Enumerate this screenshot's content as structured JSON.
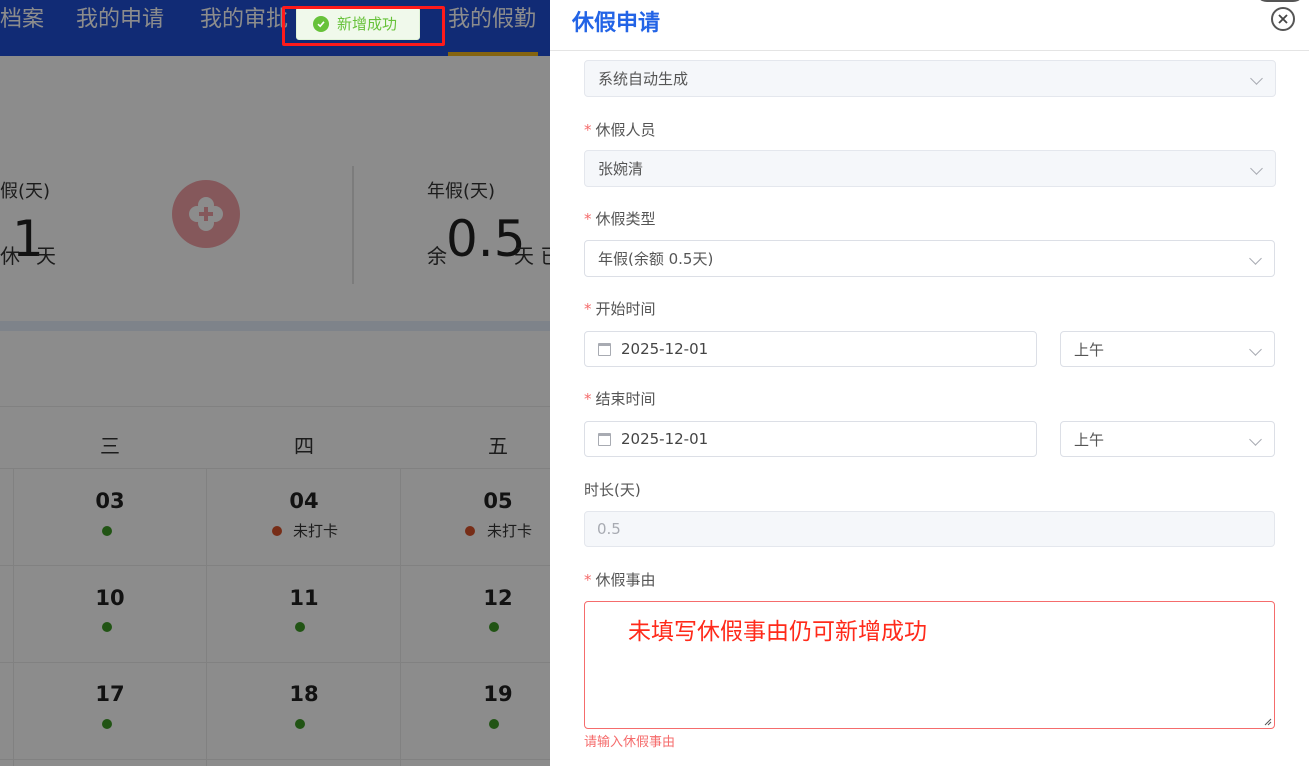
{
  "nav": {
    "tabs": [
      {
        "label": "档案"
      },
      {
        "label": "我的申请"
      },
      {
        "label": "我的审批"
      },
      {
        "label": "我的假勤",
        "active": true
      }
    ]
  },
  "toast": {
    "text": "新增成功",
    "type": "success",
    "color": "#67c23a"
  },
  "summary": {
    "left": {
      "label": "假(天)",
      "prefix": "休",
      "value": "1",
      "unit": "天"
    },
    "right": {
      "label": "年假(天)",
      "prefix": "余",
      "value": "0.5",
      "unit": "天 已"
    }
  },
  "calendar": {
    "weekdays": [
      "三",
      "四",
      "五"
    ],
    "rows": [
      [
        {
          "date": "03",
          "status": "ok",
          "status_text": ""
        },
        {
          "date": "04",
          "status": "miss",
          "status_text": "未打卡"
        },
        {
          "date": "05",
          "status": "miss",
          "status_text": "未打卡"
        }
      ],
      [
        {
          "date": "10",
          "status": "ok",
          "status_text": ""
        },
        {
          "date": "11",
          "status": "ok",
          "status_text": ""
        },
        {
          "date": "12",
          "status": "ok",
          "status_text": ""
        }
      ],
      [
        {
          "date": "17",
          "status": "ok",
          "status_text": ""
        },
        {
          "date": "18",
          "status": "ok",
          "status_text": ""
        },
        {
          "date": "19",
          "status": "ok",
          "status_text": ""
        }
      ]
    ],
    "colors": {
      "ok": "#3c9a26",
      "miss": "#d9532b"
    }
  },
  "drawer": {
    "title": "休假申请",
    "fields": {
      "number": {
        "value": "系统自动生成"
      },
      "person": {
        "label": "休假人员",
        "value": "张婉清",
        "required": true
      },
      "type": {
        "label": "休假类型",
        "value": "年假(余额 0.5天)",
        "required": true
      },
      "start": {
        "label": "开始时间",
        "date": "2025-12-01",
        "half": "上午",
        "required": true
      },
      "end": {
        "label": "结束时间",
        "date": "2025-12-01",
        "half": "上午",
        "required": true
      },
      "duration": {
        "label": "时长(天)",
        "value": "0.5"
      },
      "reason": {
        "label": "休假事由",
        "value": "",
        "required": true,
        "error": "请输入休假事由"
      }
    }
  },
  "annotation": {
    "text": "未填写休假事由仍可新增成功",
    "color": "#ff2a1a"
  },
  "colors": {
    "accent": "#2364e6",
    "nav": "#1f4fd6",
    "error": "#f56c6c",
    "success": "#67c23a"
  }
}
